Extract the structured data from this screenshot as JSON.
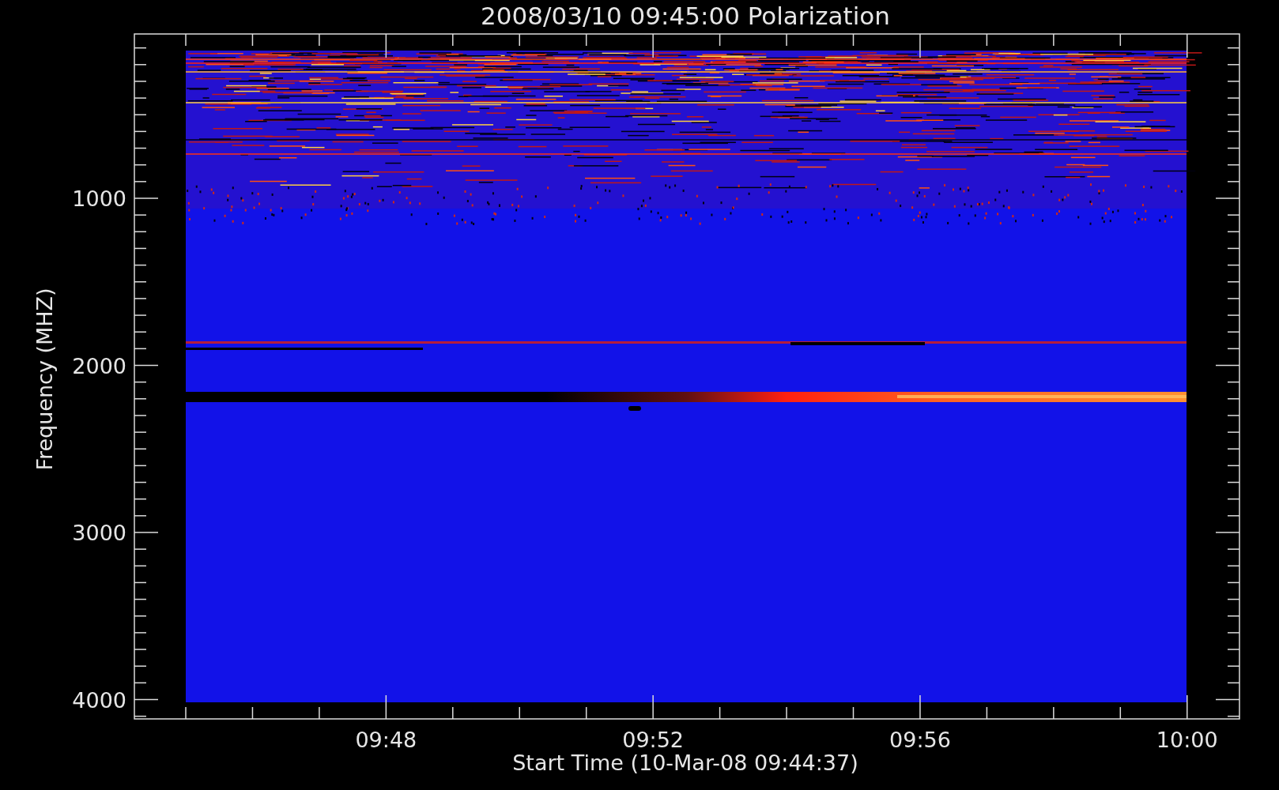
{
  "title": "2008/03/10 09:45:00 Polarization",
  "y_axis": {
    "label": "Frequency (MHZ)",
    "ticks": [
      "1000",
      "2000",
      "3000",
      "4000"
    ]
  },
  "x_axis": {
    "label": "Start Time (10-Mar-08 09:44:37)",
    "ticks": [
      "09:48",
      "09:52",
      "09:56",
      "10:00"
    ]
  }
}
